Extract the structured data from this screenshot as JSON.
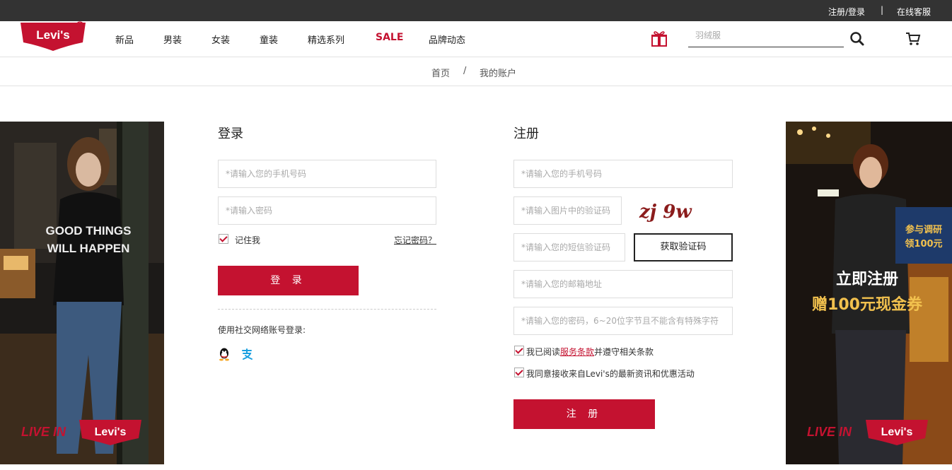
{
  "topbar": {
    "register_login": "注册/登录",
    "separator": "|",
    "customer_service": "在线客服"
  },
  "header": {
    "logo_text": "Levi's",
    "nav": [
      "新品",
      "男装",
      "女装",
      "童装",
      "精选系列",
      "SALE",
      "品牌动态"
    ],
    "search_placeholder": "羽绒服"
  },
  "breadcrumb": {
    "home": "首页",
    "sep": "/",
    "current": "我的账户"
  },
  "login": {
    "title": "登录",
    "phone_placeholder": "*请输入您的手机号码",
    "password_placeholder": "*请输入密码",
    "remember": "记住我",
    "forgot": "忘记密码？",
    "submit": "登 录",
    "social_label": "使用社交网络账号登录:"
  },
  "register": {
    "title": "注册",
    "phone_placeholder": "*请输入您的手机号码",
    "captcha_placeholder": "*请输入图片中的验证码",
    "captcha_text": "zj 9w",
    "sms_placeholder": "*请输入您的短信验证码",
    "sms_button": "获取验证码",
    "email_placeholder": "*请输入您的邮箱地址",
    "password_placeholder": "*请输入您的密码，6~20位字节且不能含有特殊字符",
    "agree_prefix": "我已阅读",
    "agree_link": "服务条款",
    "agree_suffix": "并遵守相关条款",
    "newsletter": "我同意接收来自Levi's的最新资讯和优惠活动",
    "submit": "注 册"
  },
  "banner_left": {
    "shirt_line1": "GOOD THINGS",
    "shirt_line2": "WILL HAPPEN",
    "tagline": "LIVE IN",
    "brand": "Levi's"
  },
  "banner_right": {
    "badge_line1": "参与调研",
    "badge_line2": "领100元",
    "headline1": "立即注册",
    "headline2": "赠100元现金券",
    "tagline": "LIVE IN",
    "brand": "Levi's"
  },
  "colors": {
    "brand_red": "#c41230",
    "topbar": "#333333",
    "gold": "#f2c14e"
  }
}
